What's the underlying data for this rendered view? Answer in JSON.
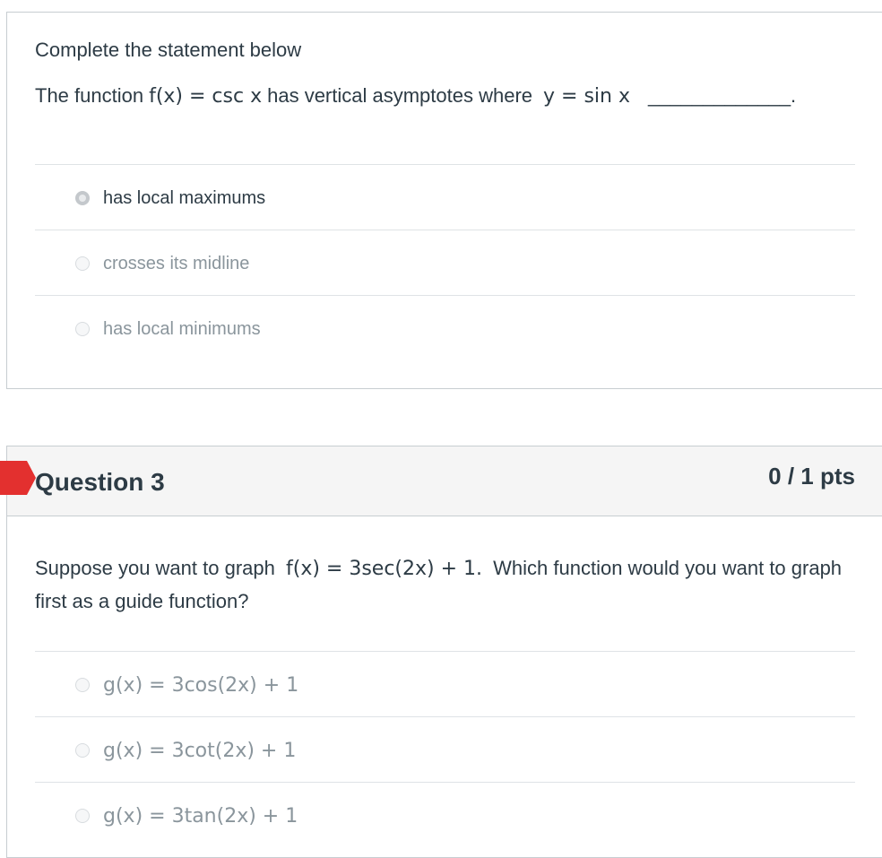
{
  "q2": {
    "prompt": "Complete the statement below",
    "stmt_pre": "The function",
    "stmt_fx": "f(x) = csc x",
    "stmt_mid": "has vertical asymptotes where",
    "stmt_y": "y = sin x",
    "blank": "_____________.",
    "answers": [
      {
        "label": "has local maximums",
        "selected": true
      },
      {
        "label": "crosses its midline",
        "selected": false
      },
      {
        "label": "has local minimums",
        "selected": false
      }
    ]
  },
  "q3": {
    "title": "Question 3",
    "points": "0 / 1 pts",
    "text_pre": "Suppose you want to graph",
    "text_fx": "f(x) = 3sec(2x) + 1.",
    "text_post": "Which function would you want to graph first as a guide function?",
    "answers": [
      {
        "label": "g(x) = 3cos(2x) + 1"
      },
      {
        "label": "g(x) = 3cot(2x) + 1"
      },
      {
        "label": "g(x) = 3tan(2x) + 1"
      }
    ]
  },
  "colors": {
    "flag": "#e3302f",
    "text": "#2d3b45",
    "border": "#c7cdd1"
  }
}
